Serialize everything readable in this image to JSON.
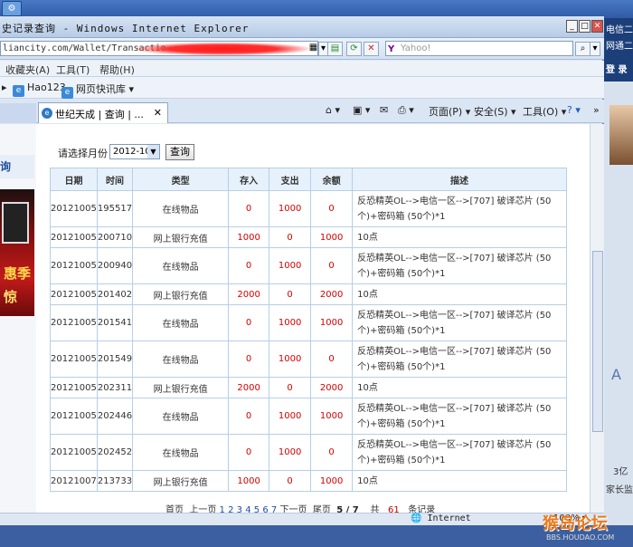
{
  "window": {
    "title": "史记录查询 - Windows Internet Explorer",
    "address": "liancity.com/Wallet/Transactio",
    "search_placeholder": "Yahoo!",
    "search_logo": "Y"
  },
  "menubar": {
    "items": [
      "收藏夹(A)",
      "工具(T)",
      "帮助(H)"
    ]
  },
  "favorites": {
    "items": [
      "Hao123",
      "网页快讯库 ▾"
    ]
  },
  "tab": {
    "label": "世纪天成 | 查询 | ...",
    "close": "✕"
  },
  "commandbar": {
    "items": [
      "页面(P) ▾",
      "安全(S) ▾",
      "工具(O) ▾"
    ]
  },
  "leftpanel": {
    "tab_text": "询",
    "ad_line1": "惠季",
    "ad_line2": "惊"
  },
  "filter": {
    "label": "请选择月份：",
    "selected": "2012-10",
    "button": "查询"
  },
  "table": {
    "headers": [
      "日期",
      "时间",
      "类型",
      "存入",
      "支出",
      "余额",
      "描述"
    ],
    "rows": [
      {
        "date": "20121005",
        "time": "195517",
        "type": "在线物品",
        "in": "0",
        "out": "1000",
        "balance": "0",
        "desc": "反恐精英OL-->电信一区-->[707] 破译芯片 (50个)+密码箱 (50个)*1"
      },
      {
        "date": "20121005",
        "time": "200710",
        "type": "网上银行充值",
        "in": "1000",
        "out": "0",
        "balance": "1000",
        "desc": "10点"
      },
      {
        "date": "20121005",
        "time": "200940",
        "type": "在线物品",
        "in": "0",
        "out": "1000",
        "balance": "0",
        "desc": "反恐精英OL-->电信一区-->[707] 破译芯片 (50个)+密码箱 (50个)*1"
      },
      {
        "date": "20121005",
        "time": "201402",
        "type": "网上银行充值",
        "in": "2000",
        "out": "0",
        "balance": "2000",
        "desc": "10点"
      },
      {
        "date": "20121005",
        "time": "201541",
        "type": "在线物品",
        "in": "0",
        "out": "1000",
        "balance": "1000",
        "desc": "反恐精英OL-->电信一区-->[707] 破译芯片 (50个)+密码箱 (50个)*1"
      },
      {
        "date": "20121005",
        "time": "201549",
        "type": "在线物品",
        "in": "0",
        "out": "1000",
        "balance": "0",
        "desc": "反恐精英OL-->电信一区-->[707] 破译芯片 (50个)+密码箱 (50个)*1"
      },
      {
        "date": "20121005",
        "time": "202311",
        "type": "网上银行充值",
        "in": "2000",
        "out": "0",
        "balance": "2000",
        "desc": "10点"
      },
      {
        "date": "20121005",
        "time": "202446",
        "type": "在线物品",
        "in": "0",
        "out": "1000",
        "balance": "1000",
        "desc": "反恐精英OL-->电信一区-->[707] 破译芯片 (50个)+密码箱 (50个)*1"
      },
      {
        "date": "20121005",
        "time": "202452",
        "type": "在线物品",
        "in": "0",
        "out": "1000",
        "balance": "0",
        "desc": "反恐精英OL-->电信一区-->[707] 破译芯片 (50个)+密码箱 (50个)*1"
      },
      {
        "date": "20121007",
        "time": "213733",
        "type": "网上银行充值",
        "in": "1000",
        "out": "0",
        "balance": "1000",
        "desc": "10点"
      }
    ]
  },
  "pager": {
    "first": "首页",
    "prev": "上一页",
    "pages": [
      "1",
      "2",
      "3",
      "4",
      "5",
      "6",
      "7"
    ],
    "next": "下一页",
    "last": "尾页",
    "current": "5 / 7",
    "total_prefix": "共",
    "total": "61",
    "total_suffix": "条记录"
  },
  "statusbar": {
    "zone": "Internet",
    "zoom": "100% ▾"
  },
  "rightstrip": {
    "line1": "电信二区",
    "line2": "网通二区",
    "line3": "登 录",
    "letter": "A",
    "bottom": "3亿",
    "footer": "家长监"
  },
  "watermark": {
    "main": "猴岛论坛",
    "sub": "BBS.HOUDAO.COM"
  },
  "colors": {
    "red_amount": "#d40000",
    "header_bg": "#e6f1fb",
    "border": "#b6cfe6",
    "link": "#1f4ea3"
  }
}
